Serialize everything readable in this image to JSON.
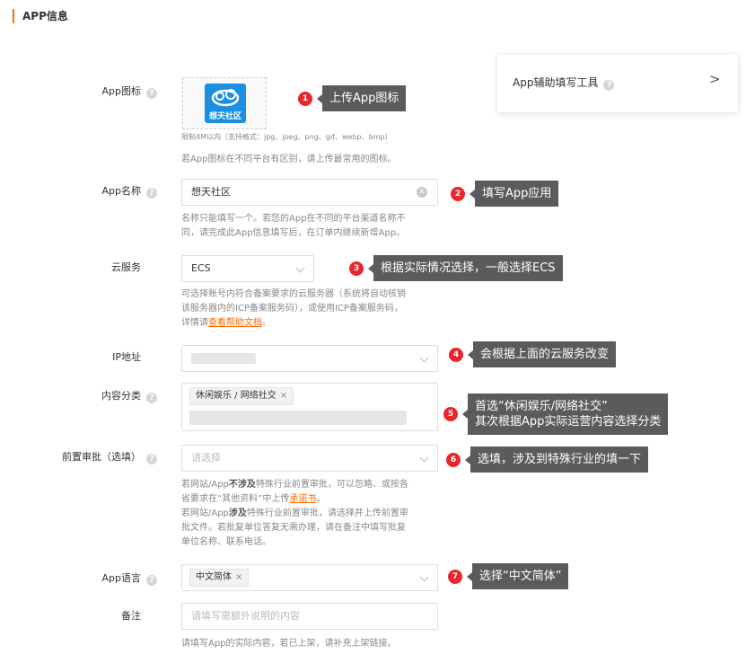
{
  "section": {
    "title": "APP信息"
  },
  "helper_card": {
    "label": "App辅助填写工具",
    "chevron": ">"
  },
  "icon_field": {
    "label": "App图标",
    "logo_text": "想天社区",
    "limit_hint": "限制4M以内（支持格式：jpg、jpeg、png、gif、webp、bmp）",
    "hint": "若App图标在不同平台有区别，请上传最常用的图标。"
  },
  "name_field": {
    "label": "App名称",
    "value": "想天社区",
    "hint_line1": "名称只能填写一个。若您的App在不同的平台渠道名称不",
    "hint_line2": "同，请完成此App信息填写后，在订单内继续新增App。"
  },
  "cloud_field": {
    "label": "云服务",
    "value": "ECS",
    "hint_line1": "可选择账号内符合备案要求的云服务器（系统将自动核销",
    "hint_line2": "该服务器内的ICP备案服务码），或使用ICP备案服务码，",
    "hint_line3_prefix": "详情请",
    "hint_link": "查看帮助文档",
    "hint_line3_suffix": "。"
  },
  "ip_field": {
    "label": "IP地址"
  },
  "category_field": {
    "label": "内容分类",
    "tag": "休闲娱乐 / 网络社交"
  },
  "preapproval_field": {
    "label": "前置审批（选填）",
    "placeholder": "请选择",
    "h1a": "若网站/App",
    "h1b": "不涉及",
    "h1c": "特殊行业前置审批，可以忽略、或按各",
    "h2a": "省要求在“其他资料”中上传",
    "h2link": "承诺书",
    "h2c": "。",
    "h3a": "若网站/App",
    "h3b": "涉及",
    "h3c": "特殊行业前置审批，请选择并上传前置审",
    "h4": "批文件。若批复单位答复无需办理，请在备注中填写批复",
    "h5": "单位名称、联系电话。"
  },
  "language_field": {
    "label": "App语言",
    "tag": "中文简体"
  },
  "remark_field": {
    "label": "备注",
    "placeholder": "请填写需额外说明的内容",
    "hint": "请填写App的实际内容，若已上架，请补充上架链接。"
  },
  "annotations": [
    {
      "num": "1",
      "text": "上传App图标"
    },
    {
      "num": "2",
      "text": "填写App应用"
    },
    {
      "num": "3",
      "text": "根据实际情况选择，一般选择ECS"
    },
    {
      "num": "4",
      "text": "会根据上面的云服务改变"
    },
    {
      "num": "5",
      "text": "首选“休闲娱乐/网络社交”\n其次根据App实际运营内容选择分类"
    },
    {
      "num": "6",
      "text": "选填，涉及到特殊行业的填一下"
    },
    {
      "num": "7",
      "text": "选择“中文简体”"
    }
  ],
  "colors": {
    "accent": "#ff6a00",
    "badge": "#e9262c",
    "bubble": "#5b5b5b",
    "logo": "#1a8fe3"
  }
}
